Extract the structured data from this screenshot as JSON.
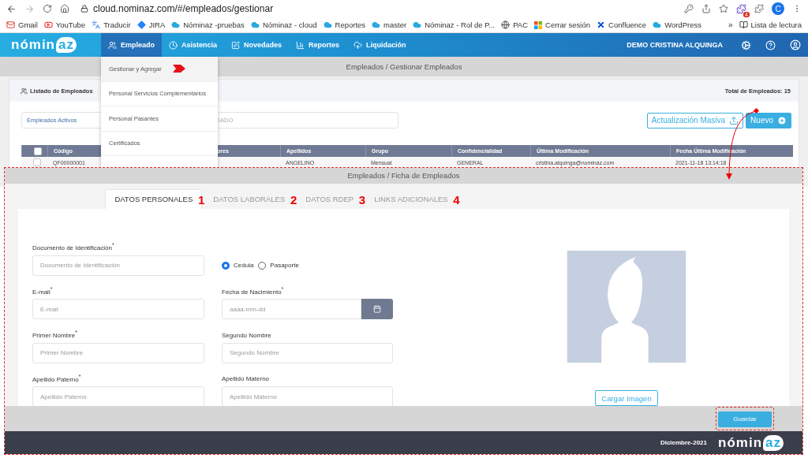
{
  "browser": {
    "url": "cloud.nominaz.com/#/empleados/gestionar",
    "extension_badge": "4",
    "profile": "C"
  },
  "bookmarks": [
    {
      "label": "Gmail",
      "kind": "mail"
    },
    {
      "label": "YouTube",
      "kind": "video"
    },
    {
      "label": "Traducir",
      "kind": "translate"
    },
    {
      "label": "JIRA",
      "kind": "diamond"
    },
    {
      "label": "Nóminaz -pruebas",
      "kind": "cloud"
    },
    {
      "label": "Nóminaz - cloud",
      "kind": "cloud"
    },
    {
      "label": "Reportes",
      "kind": "cloud"
    },
    {
      "label": "master",
      "kind": "cloud"
    },
    {
      "label": "Nóminaz - Rol de P...",
      "kind": "cloud"
    },
    {
      "label": "PAC",
      "kind": "globe"
    },
    {
      "label": "Cerrar sesión",
      "kind": "grid"
    },
    {
      "label": "Confluence",
      "kind": "cross"
    },
    {
      "label": "WordPress",
      "kind": "cloud"
    }
  ],
  "bookmarks_more": "»",
  "reading_list": "Lista de lectura",
  "nav": {
    "logo": {
      "main": "nómin",
      "accent": "az"
    },
    "items": [
      {
        "label": "Empleado",
        "selected": true,
        "kind": "users"
      },
      {
        "label": "Asistencia",
        "selected": false,
        "kind": "clock"
      },
      {
        "label": "Novedades",
        "selected": false,
        "kind": "edit"
      },
      {
        "label": "Reportes",
        "selected": false,
        "kind": "chart"
      },
      {
        "label": "Liquidación",
        "selected": false,
        "kind": "upload"
      }
    ],
    "user": "DEMO CRISTINA ALQUINGA"
  },
  "breadcrumb": "Empleados / Gestionar Empleados",
  "menu": {
    "items": [
      {
        "label": "Gestionar y Agregar",
        "selected": true
      },
      {
        "label": "Personal Servicios Complementarios",
        "selected": false
      },
      {
        "label": "Personal Pasantes",
        "selected": false
      },
      {
        "label": "Certificados",
        "selected": false
      }
    ]
  },
  "listing": {
    "title": "Listado de Empleados",
    "total": "Total de Empleados: 15",
    "filter": "Empleados Activos",
    "search_placeholder": "EADO",
    "buttons": [
      {
        "label": "Actualización Masiva",
        "kind": "outline"
      },
      {
        "label": "Nuevo",
        "kind": "primary"
      }
    ],
    "header_checked": false,
    "columns": [
      "Código",
      "ores",
      "Apellidos",
      "Grupo",
      "Confidencialidad",
      "Última Modificación",
      "Fecha Última Modificación"
    ],
    "rows": [
      {
        "checked": false,
        "cells": [
          "QF00000001",
          null,
          "ANGELINO",
          "Mensual",
          "GENERAL",
          "cristina.alquinga@nominaz.com",
          "2021-11-18 13:14:18"
        ]
      }
    ]
  },
  "form": {
    "breadcrumb": "Empleados / Ficha de Empleados",
    "tabs": [
      {
        "label": "DATOS PERSONALES",
        "selected": true,
        "marker": "1"
      },
      {
        "label": "DATOS LABORALES",
        "selected": false,
        "marker": "2"
      },
      {
        "label": "DATOS RDEP",
        "selected": false,
        "marker": "3"
      },
      {
        "label": "LINKS ADICIONALES",
        "selected": false,
        "marker": "4"
      }
    ],
    "fields": [
      {
        "kind": "text",
        "label": "Documento de Identificación$^{*}$",
        "placeholder": "Documento de Identificación"
      },
      {
        "kind": "radio",
        "options": [
          {
            "label": "Cedula",
            "selected": true
          },
          {
            "label": "Pasaporte",
            "selected": false
          }
        ]
      },
      {
        "kind": "text",
        "label": "E-mail$^{*}$",
        "placeholder": "E-mail"
      },
      {
        "kind": "date",
        "label": "Fecha de Nacimiento$^{*}$",
        "placeholder": "aaaa-mm-dd"
      },
      {
        "kind": "text",
        "label": "Primer Nombre$^{*}$",
        "placeholder": "Primer Nombre"
      },
      {
        "kind": "text",
        "label": "Segundo Nombre",
        "placeholder": "Segundo Nombre"
      },
      {
        "kind": "text",
        "label": "Apellido Paterno$^{*}$",
        "placeholder": "Apellido Paterno"
      },
      {
        "kind": "text",
        "label": "Apellido Materno",
        "placeholder": "Apellido Materno"
      }
    ],
    "upload_button": "Cargar Imagen",
    "save_button": "Guardar",
    "footer_date": "Diciembre-2021",
    "footer_logo": {
      "main": "nómin",
      "accent": "az"
    }
  }
}
